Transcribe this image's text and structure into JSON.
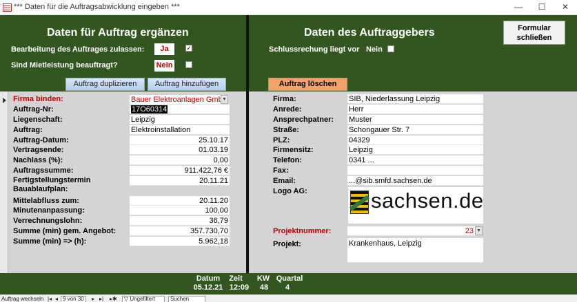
{
  "window": {
    "title": "*** Daten für die Auftragsabwicklung eingeben ***",
    "minimize": "—",
    "maximize": "☐",
    "close": "✕"
  },
  "left_header": {
    "title": "Daten für Auftrag ergänzen",
    "allow_label": "Bearbeitung des Auftrages zulassen:",
    "allow_value": "Ja",
    "allow_checked": "✓",
    "rent_label": "Sind Mietleistung beauftragt?",
    "rent_value": "Nein",
    "btn_duplicate": "Auftrag duplizieren",
    "btn_add": "Auftrag hinzufügen"
  },
  "right_header": {
    "title": "Daten des Auftraggebers",
    "invoice_label": "Schlussrechung liegt vor",
    "invoice_value": "Nein",
    "btn_delete": "Auftrag löschen",
    "btn_close": "Formular schließen"
  },
  "order": {
    "firma_label": "Firma binden:",
    "firma_value": "Bauer Elektroanlagen GmbH",
    "nr_label": "Auftrag-Nr:",
    "nr_value": "17O60314",
    "liegenschaft_label": "Liegenschaft:",
    "liegenschaft_value": "Leipzig",
    "auftrag_label": "Auftrag:",
    "auftrag_value": "Elektroinstallation",
    "datum_label": "Auftrag-Datum:",
    "datum_value": "25.10.17",
    "vertragsende_label": "Vertragsende:",
    "vertragsende_value": "01.03.19",
    "nachlass_label": "Nachlass (%):",
    "nachlass_value": "0,00",
    "summe_label": "Auftragssumme:",
    "summe_value": "911.422,76 €",
    "fertig_label_1": "Fertigstellungstermin",
    "fertig_label_2": "Bauablaufplan:",
    "fertig_value": "20.11.21",
    "mittelabfluss_label": "Mittelabfluss zum:",
    "mittelabfluss_value": "20.11.20",
    "minuten_label": "Minutenanpassung:",
    "minuten_value": "100,00",
    "verrechnung_label": "Verrechnungslohn:",
    "verrechnung_value": "36,79",
    "summe_min_label": "Summe (min) gem. Angebot:",
    "summe_min_value": "357.730,70",
    "summe_h_label": "Summe (min) => (h):",
    "summe_h_value": "5.962,18"
  },
  "client": {
    "firma_label": "Firma:",
    "firma_value": "SIB, Niederlassung Leipzig",
    "anrede_label": "Anrede:",
    "anrede_value": "Herr",
    "ansprech_label": "Ansprechpatner:",
    "ansprech_value": "Muster",
    "strasse_label": "Straße:",
    "strasse_value": "Schongauer Str. 7",
    "plz_label": "PLZ:",
    "plz_value": "04329",
    "sitz_label": "Firmensitz:",
    "sitz_value": "Leipzig",
    "telefon_label": "Telefon:",
    "telefon_value": "0341 ...",
    "fax_label": "Fax:",
    "fax_value": "",
    "email_label": "Email:",
    "email_value": "...@sib.smfd.sachsen.de",
    "logo_label": "Logo AG:",
    "logo_text": "sachsen.de",
    "projekt_nr_label": "Projektnummer:",
    "projekt_nr_value": "23",
    "projekt_label": "Projekt:",
    "projekt_value": "Krankenhaus, Leipzig"
  },
  "footer": {
    "datum_label": "Datum",
    "datum_value": "05.12.21",
    "zeit_label": "Zeit",
    "zeit_value": "12:09",
    "kw_label": "KW",
    "kw_value": "48",
    "quartal_label": "Quartal",
    "quartal_value": "4"
  },
  "navigation": {
    "record_label": "Auftrag wechseln",
    "first": "|◂",
    "prev": "◂",
    "position": "9 von 30",
    "next": "▸",
    "last": "▸|",
    "new": "▸✱",
    "filter": "Ungefiltert",
    "search": "Suchen"
  },
  "colors": {
    "header_green": "#33551f",
    "field_red": "#c00000",
    "delete_orange": "#f2a36a"
  }
}
